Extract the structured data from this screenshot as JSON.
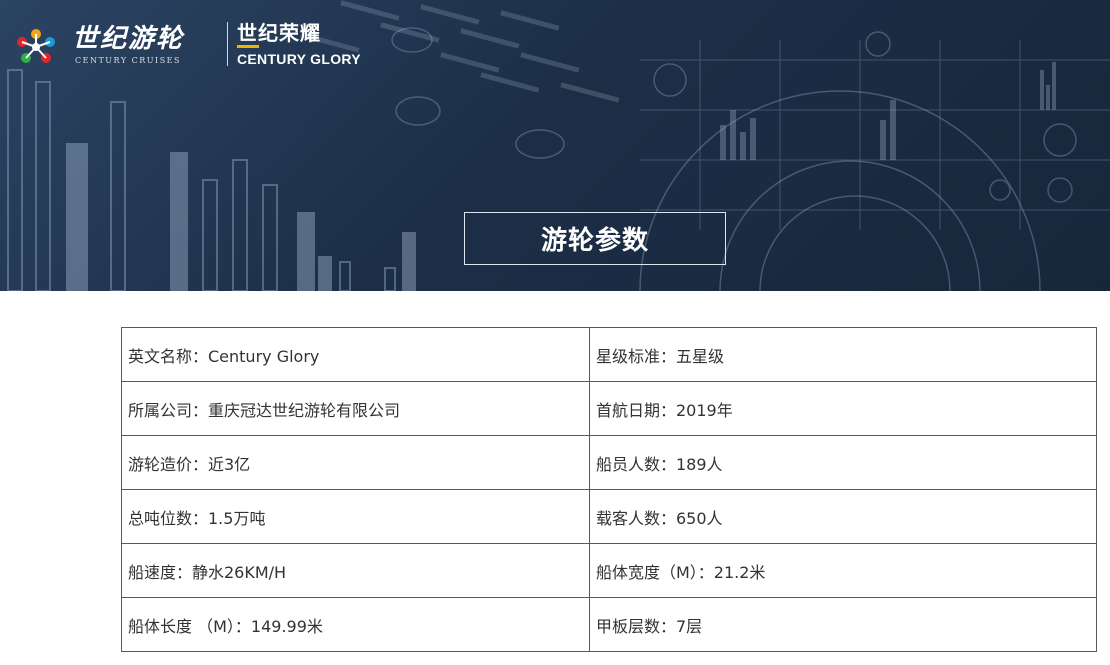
{
  "brand": {
    "name_cn": "世纪游轮",
    "name_en": "CENTURY CRUISES"
  },
  "ship": {
    "name_cn": "世纪荣耀",
    "name_en": "CENTURY GLORY"
  },
  "banner": {
    "title": "游轮参数"
  },
  "params": {
    "rows": [
      {
        "left": "英文名称：Century Glory",
        "right": "星级标准：五星级"
      },
      {
        "left": "所属公司：重庆冠达世纪游轮有限公司",
        "right": "首航日期：2019年"
      },
      {
        "left": "游轮造价：近3亿",
        "right": "船员人数：189人"
      },
      {
        "left": "总吨位数：1.5万吨",
        "right": "载客人数：650人"
      },
      {
        "left": "船速度：静水26KM/H",
        "right": "船体宽度（M）：21.2米"
      },
      {
        "left": "船体长度 （M）：149.99米",
        "right": "甲板层数：7层"
      }
    ]
  },
  "colors": {
    "banner_dark": "#17273b",
    "banner_light": "#2b4463",
    "accent_yellow": "#f0b400",
    "table_border": "#5a5a5a",
    "text": "#333333"
  }
}
